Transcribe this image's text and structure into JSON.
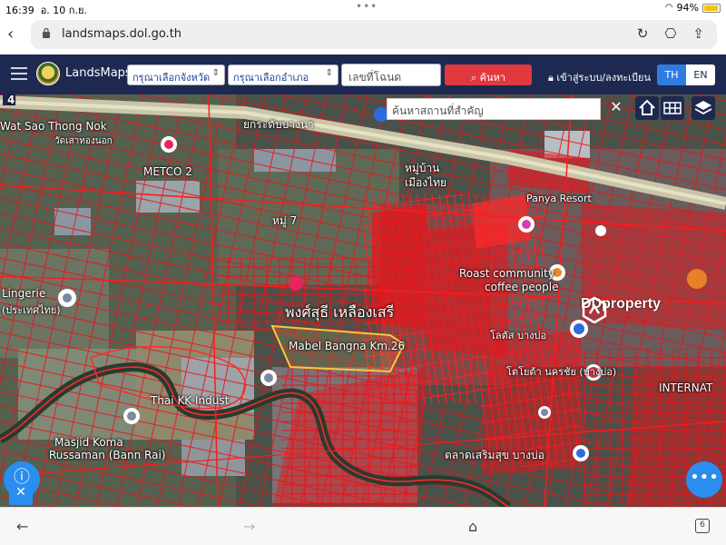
{
  "status": {
    "time": "16:39",
    "date": "อ. 10 ก.ย.",
    "battery": "94%"
  },
  "browser": {
    "url": "landsmaps.dol.go.th",
    "tabs_count": "6"
  },
  "nav": {
    "brand": "LandsMaps",
    "province_placeholder": "กรุณาเลือกจังหวัด",
    "district_placeholder": "กรุณาเลือกอำเภอ",
    "deed_placeholder": "เลขที่โฉนด",
    "search_label": "ค้นหา",
    "login_label": "เข้าสู่ระบบ/ลงทะเบียน",
    "lang_th": "TH",
    "lang_en": "EN"
  },
  "map": {
    "place_search_placeholder": "ค้นหาสถานที่สำคัญ",
    "labels": {
      "wat": "Wat Sao Thong Nok",
      "wat_th": "วัดเสาทองนอก",
      "metco": "METCO 2",
      "moo7": "หมู่ 7",
      "village": "หมู่บ้าน",
      "village2": "เมืองไทย",
      "lingerie": "Lingerie",
      "lingerie2": "(ประเทศไทย)",
      "roast": "Roast community",
      "coffee": "coffee people",
      "plot_owner": "พงศ์สุธี เหลืองเสรี",
      "mabel": "Mabel Bangna Km.26",
      "thaikk": "Thai KK Indust",
      "masjid": "Masjid Koma",
      "russaman": "Russaman (Bann Rai)",
      "market": "ตลาดเสริมสุข บางบ่อ",
      "internat": "INTERNAT",
      "panya": "Panya Resort",
      "toyota": "โตโยต้า นครชัย (บางบ่อ)",
      "lotus": "โลตัส บางบ่อ",
      "road_num": "4",
      "bangna_road": "ยกระดับบางนา"
    },
    "watermark": "DDproperty"
  }
}
